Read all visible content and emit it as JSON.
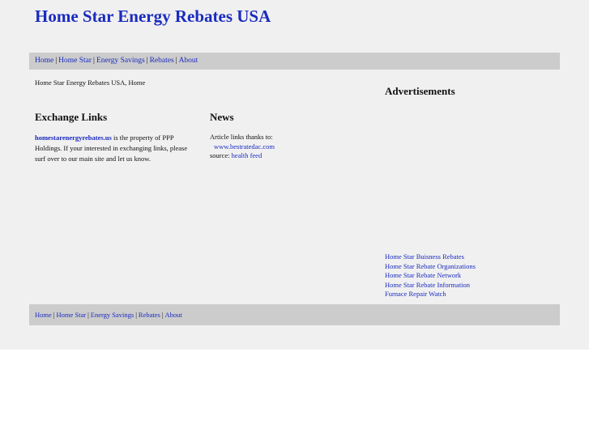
{
  "site": {
    "title": "Home Star Energy Rebates USA"
  },
  "nav": [
    "Home",
    "Home Star",
    "Energy Savings",
    "Rebates",
    "About"
  ],
  "breadcrumb": "Home Star Energy Rebates USA, Home",
  "exchange": {
    "heading": "Exchange Links",
    "link": "homestarenergyrebates.us",
    "text": " is the property of PPP Holdings. If your interested in exchanging links, please surf over to our main site and let us know."
  },
  "news": {
    "heading": "News",
    "intro": "Article links thanks to:",
    "credit_link": "www.bestratedac.com",
    "source_label": "source:",
    "source_link": "health feed"
  },
  "ads": {
    "heading": "Advertisements",
    "links": [
      "Home Star Buisness Rebates",
      "Home Star Rebate Organizations",
      "Home Star Rebate Network",
      "Home Star Rebate Information",
      "Furnace Repair Watch"
    ]
  },
  "colors": {
    "link": "#1a2bbf",
    "page_bg": "#f0f0f0",
    "nav_bg": "#cccccc"
  }
}
